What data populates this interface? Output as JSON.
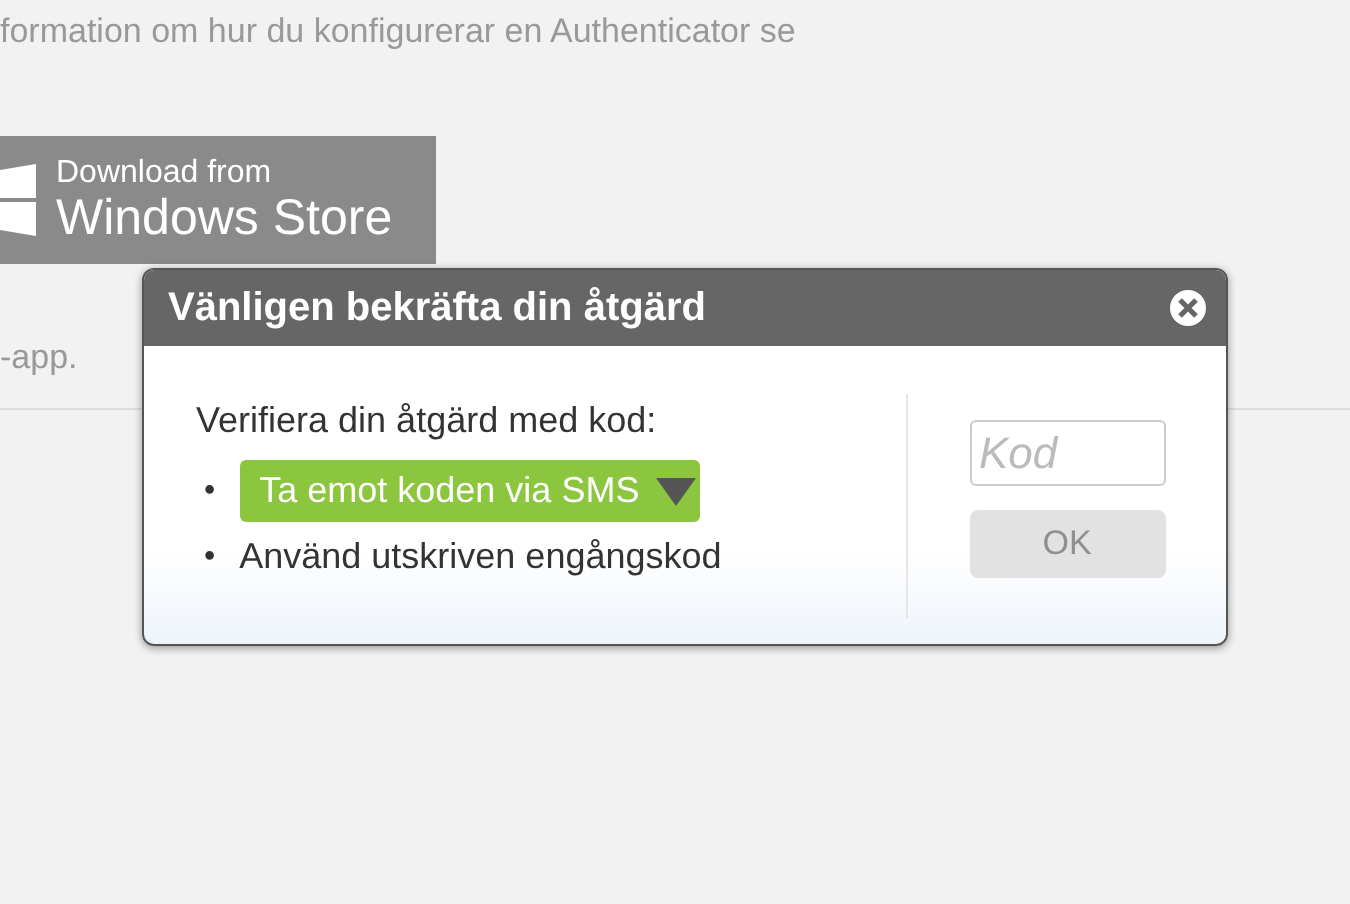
{
  "background": {
    "info_text": "formation om hur du konfigurerar en Authenticator se",
    "store_badge": {
      "line_1": "Download from",
      "line_2": "Windows Store"
    },
    "trailing_text": "-app."
  },
  "dialog": {
    "title": "Vänligen bekräfta din åtgärd",
    "prompt": "Verifiera din åtgärd med kod:",
    "options": [
      {
        "bullet": "•",
        "label": "Ta emot koden via SMS",
        "selected": true
      },
      {
        "bullet": "•",
        "label": "Använd utskriven engångskod",
        "selected": false
      }
    ],
    "code_field": {
      "placeholder": "Kod"
    },
    "ok_button": {
      "label": "OK",
      "disabled": true
    }
  }
}
